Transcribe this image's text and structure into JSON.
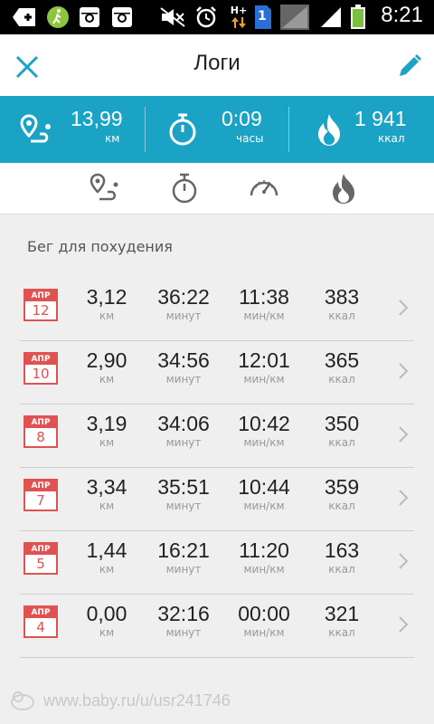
{
  "status_bar": {
    "time": "8:21",
    "network": "H+",
    "sim_badge": "1",
    "icons": [
      "add-icon",
      "walk-app-icon",
      "instagram-icon",
      "instagram-icon",
      "mute-icon",
      "alarm-icon",
      "data-arrows-icon",
      "sim-icon",
      "no-signal-icon",
      "signal-icon",
      "battery-icon"
    ]
  },
  "header": {
    "title": "Логи"
  },
  "summary": [
    {
      "value": "13,99",
      "unit": "км",
      "icon": "route-icon"
    },
    {
      "value": "0:09",
      "unit": "часы",
      "icon": "stopwatch-icon"
    },
    {
      "value": "1 941",
      "unit": "ккал",
      "icon": "flame-icon"
    }
  ],
  "tabs": [
    {
      "icon": "route-tab-icon"
    },
    {
      "icon": "stopwatch-tab-icon"
    },
    {
      "icon": "speedometer-tab-icon"
    },
    {
      "icon": "flame-tab-icon"
    }
  ],
  "section_title": "Бег для похудения",
  "units": {
    "distance": "км",
    "duration": "минут",
    "pace": "мин/км",
    "calories": "ккал"
  },
  "logs": [
    {
      "month": "АПР",
      "day": "12",
      "distance": "3,12",
      "duration": "36:22",
      "pace": "11:38",
      "calories": "383"
    },
    {
      "month": "АПР",
      "day": "10",
      "distance": "2,90",
      "duration": "34:56",
      "pace": "12:01",
      "calories": "365"
    },
    {
      "month": "АПР",
      "day": "8",
      "distance": "3,19",
      "duration": "34:06",
      "pace": "10:42",
      "calories": "350"
    },
    {
      "month": "АПР",
      "day": "7",
      "distance": "3,34",
      "duration": "35:51",
      "pace": "10:44",
      "calories": "359"
    },
    {
      "month": "АПР",
      "day": "5",
      "distance": "1,44",
      "duration": "16:21",
      "pace": "11:20",
      "calories": "163"
    },
    {
      "month": "АПР",
      "day": "4",
      "distance": "0,00",
      "duration": "32:16",
      "pace": "00:00",
      "calories": "321"
    }
  ],
  "watermark": "www.baby.ru/u/usr241746",
  "colors": {
    "accent": "#1aa3c4",
    "calendar": "#e05252",
    "header_icons": "#1aa3c4"
  }
}
